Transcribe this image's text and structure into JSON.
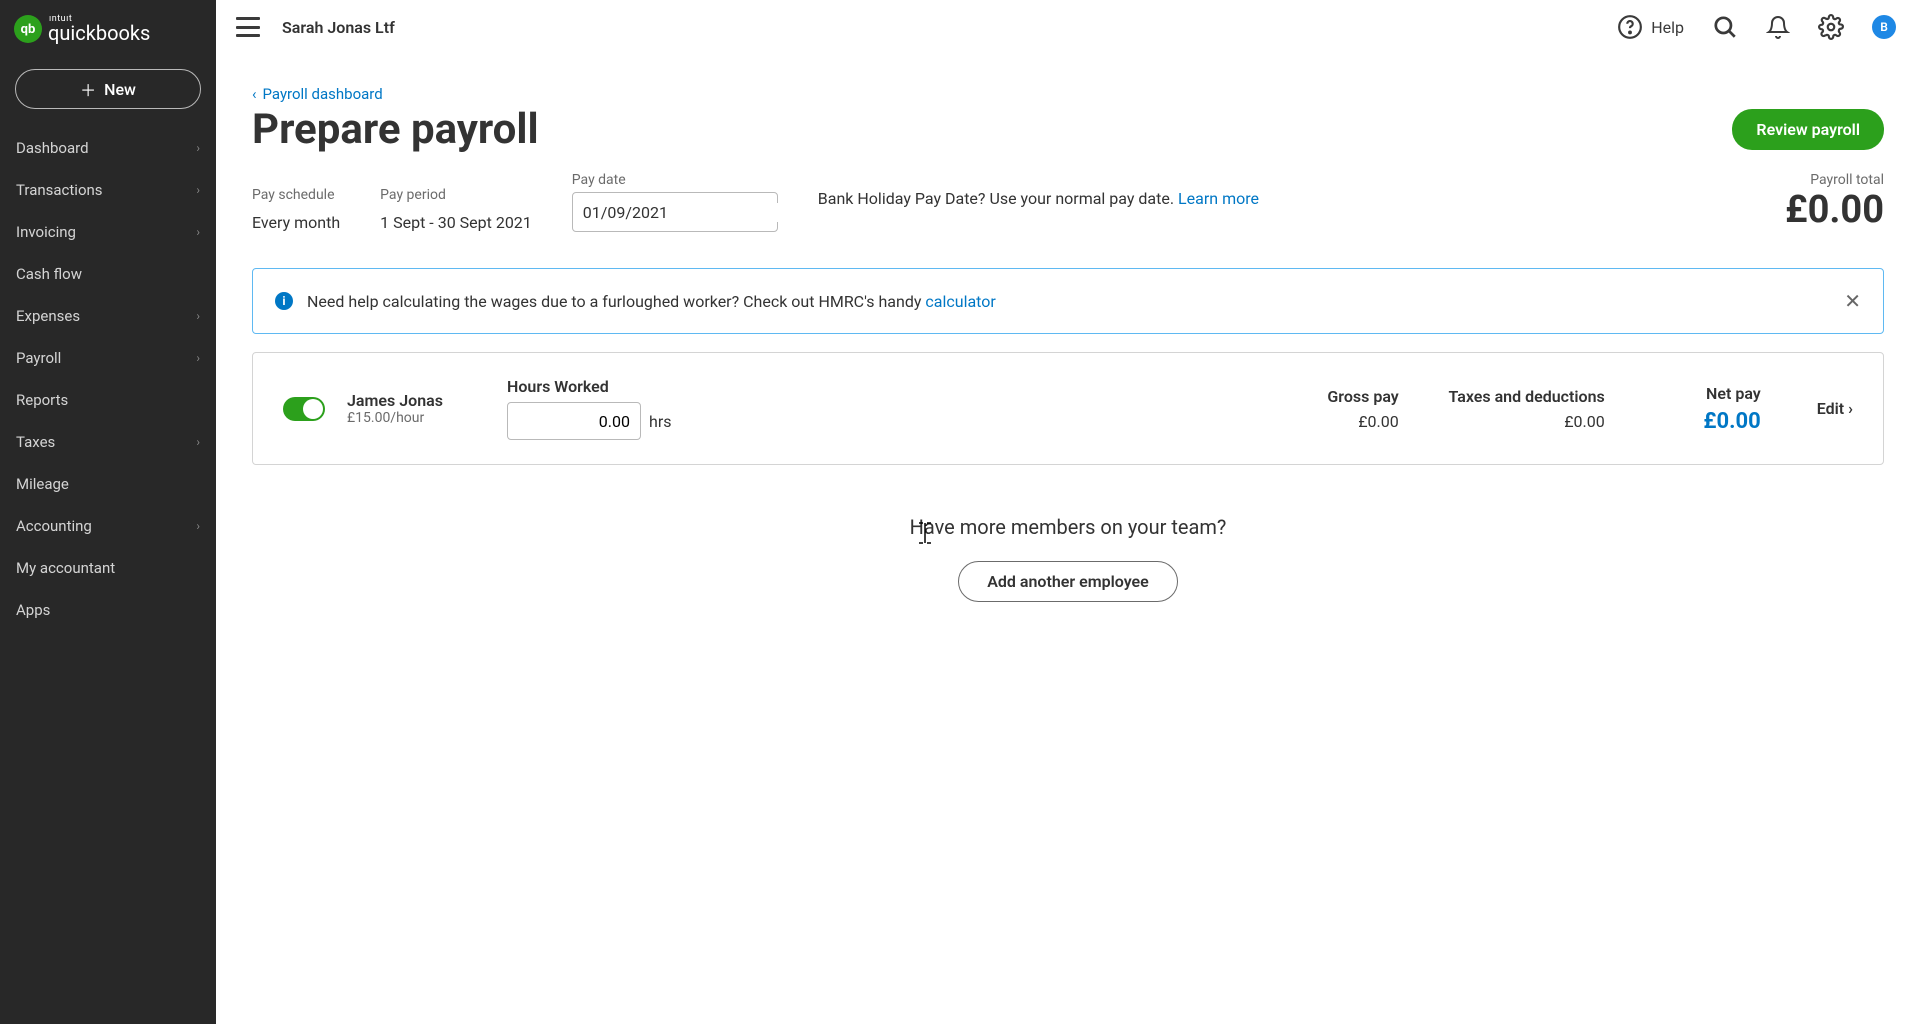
{
  "brand": {
    "short": "qb",
    "top": "ıntuıt",
    "name": "quickbooks"
  },
  "sidebar": {
    "new_label": "New",
    "items": [
      {
        "label": "Dashboard",
        "chev": true
      },
      {
        "label": "Transactions",
        "chev": true
      },
      {
        "label": "Invoicing",
        "chev": true
      },
      {
        "label": "Cash flow",
        "chev": false
      },
      {
        "label": "Expenses",
        "chev": true
      },
      {
        "label": "Payroll",
        "chev": true
      },
      {
        "label": "Reports",
        "chev": false
      },
      {
        "label": "Taxes",
        "chev": true
      },
      {
        "label": "Mileage",
        "chev": false
      },
      {
        "label": "Accounting",
        "chev": true
      },
      {
        "label": "My accountant",
        "chev": false
      },
      {
        "label": "Apps",
        "chev": false
      }
    ]
  },
  "topbar": {
    "company": "Sarah Jonas Ltf",
    "help": "Help",
    "avatar": "B"
  },
  "breadcrumb": "Payroll dashboard",
  "page_title": "Prepare payroll",
  "review_btn": "Review payroll",
  "meta": {
    "schedule_label": "Pay schedule",
    "schedule_value": "Every month",
    "period_label": "Pay period",
    "period_value": "1 Sept - 30 Sept 2021",
    "date_label": "Pay date",
    "date_value": "01/09/2021",
    "holiday_text": "Bank Holiday Pay Date? Use your normal pay date. ",
    "learn_more": "Learn more",
    "total_label": "Payroll total",
    "total_value": "£0.00"
  },
  "banner": {
    "text": "Need help calculating the wages due to a furloughed worker? Check out HMRC's handy ",
    "link": "calculator"
  },
  "employee": {
    "name": "James Jonas",
    "rate": "£15.00/hour",
    "hours_label": "Hours Worked",
    "hours_value": "0.00",
    "hrs_suffix": "hrs",
    "gross_label": "Gross pay",
    "gross_value": "£0.00",
    "tax_label": "Taxes and deductions",
    "tax_value": "£0.00",
    "net_label": "Net pay",
    "net_value": "£0.00",
    "edit": "Edit"
  },
  "footer": {
    "question": "Have more members on your team?",
    "add_btn": "Add another employee"
  }
}
